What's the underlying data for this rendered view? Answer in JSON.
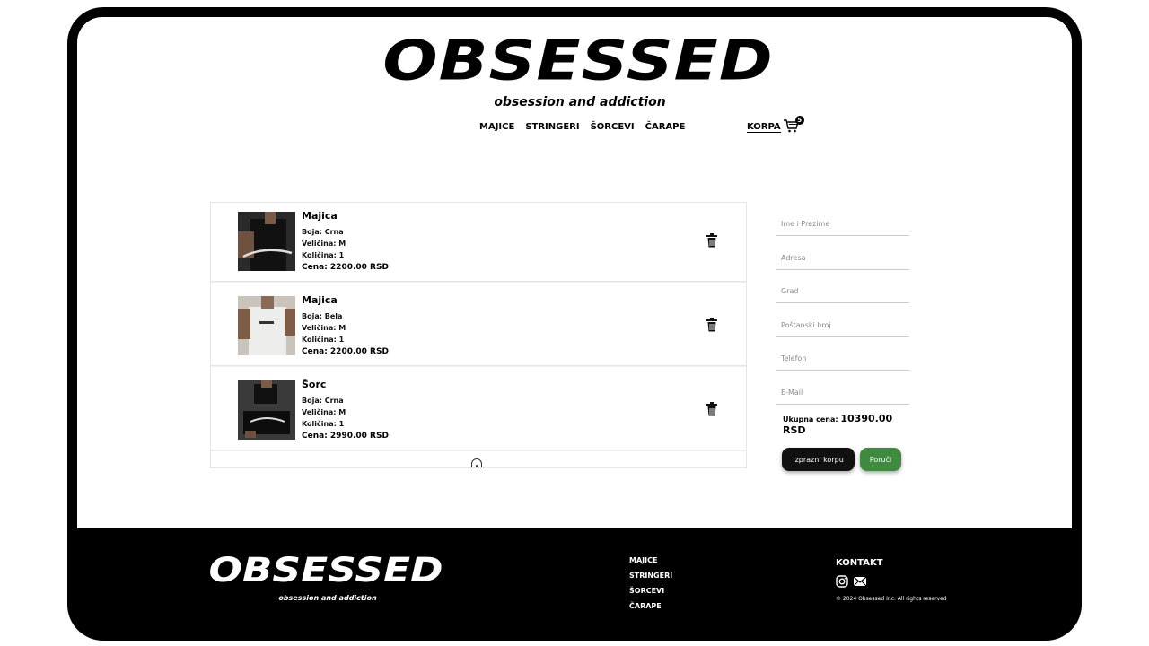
{
  "header": {
    "logo": "OBSESSED",
    "tagline": "obsession and addiction",
    "nav": [
      "MAJICE",
      "STRINGERI",
      "ŠORCEVI",
      "ČARAPE"
    ],
    "cart_label": "KORPA",
    "cart_count": "5"
  },
  "cart": {
    "items": [
      {
        "name": "Majica",
        "color": "Boja: Crna",
        "size": "Veličina: M",
        "qty": "Količina: 1",
        "price": "Cena: 2200.00 RSD"
      },
      {
        "name": "Majica",
        "color": "Boja: Bela",
        "size": "Veličina: M",
        "qty": "Količina: 1",
        "price": "Cena: 2200.00 RSD"
      },
      {
        "name": "Šorc",
        "color": "Boja: Crna",
        "size": "Veličina: M",
        "qty": "Količina: 1",
        "price": "Cena: 2990.00 RSD"
      }
    ]
  },
  "form": {
    "name_placeholder": "Ime i Prezime",
    "address_placeholder": "Adresa",
    "city_placeholder": "Grad",
    "zip_placeholder": "Poštanski broj",
    "phone_placeholder": "Telefon",
    "email_placeholder": "E-Mail",
    "total_label": "Ukupna cena:",
    "total_value": "10390.00 RSD",
    "clear_button": "Izprazni korpu",
    "order_button": "Poruči"
  },
  "footer": {
    "logo": "OBSESSED",
    "tagline": "obsession and addiction",
    "links": [
      "MAJICE",
      "STRINGERI",
      "ŠORCEVI",
      "ČARAPE"
    ],
    "contact_title": "KONTAKT",
    "copyright": "© 2024 Obsessed Inc. All rights reserved"
  },
  "colors": {
    "frame": "#000000",
    "order_button": "#3f8a3f",
    "clear_button": "#111111"
  },
  "icons": [
    "cart-icon",
    "trash-icon",
    "instagram-icon",
    "mail-icon",
    "scroll-handle-icon"
  ]
}
